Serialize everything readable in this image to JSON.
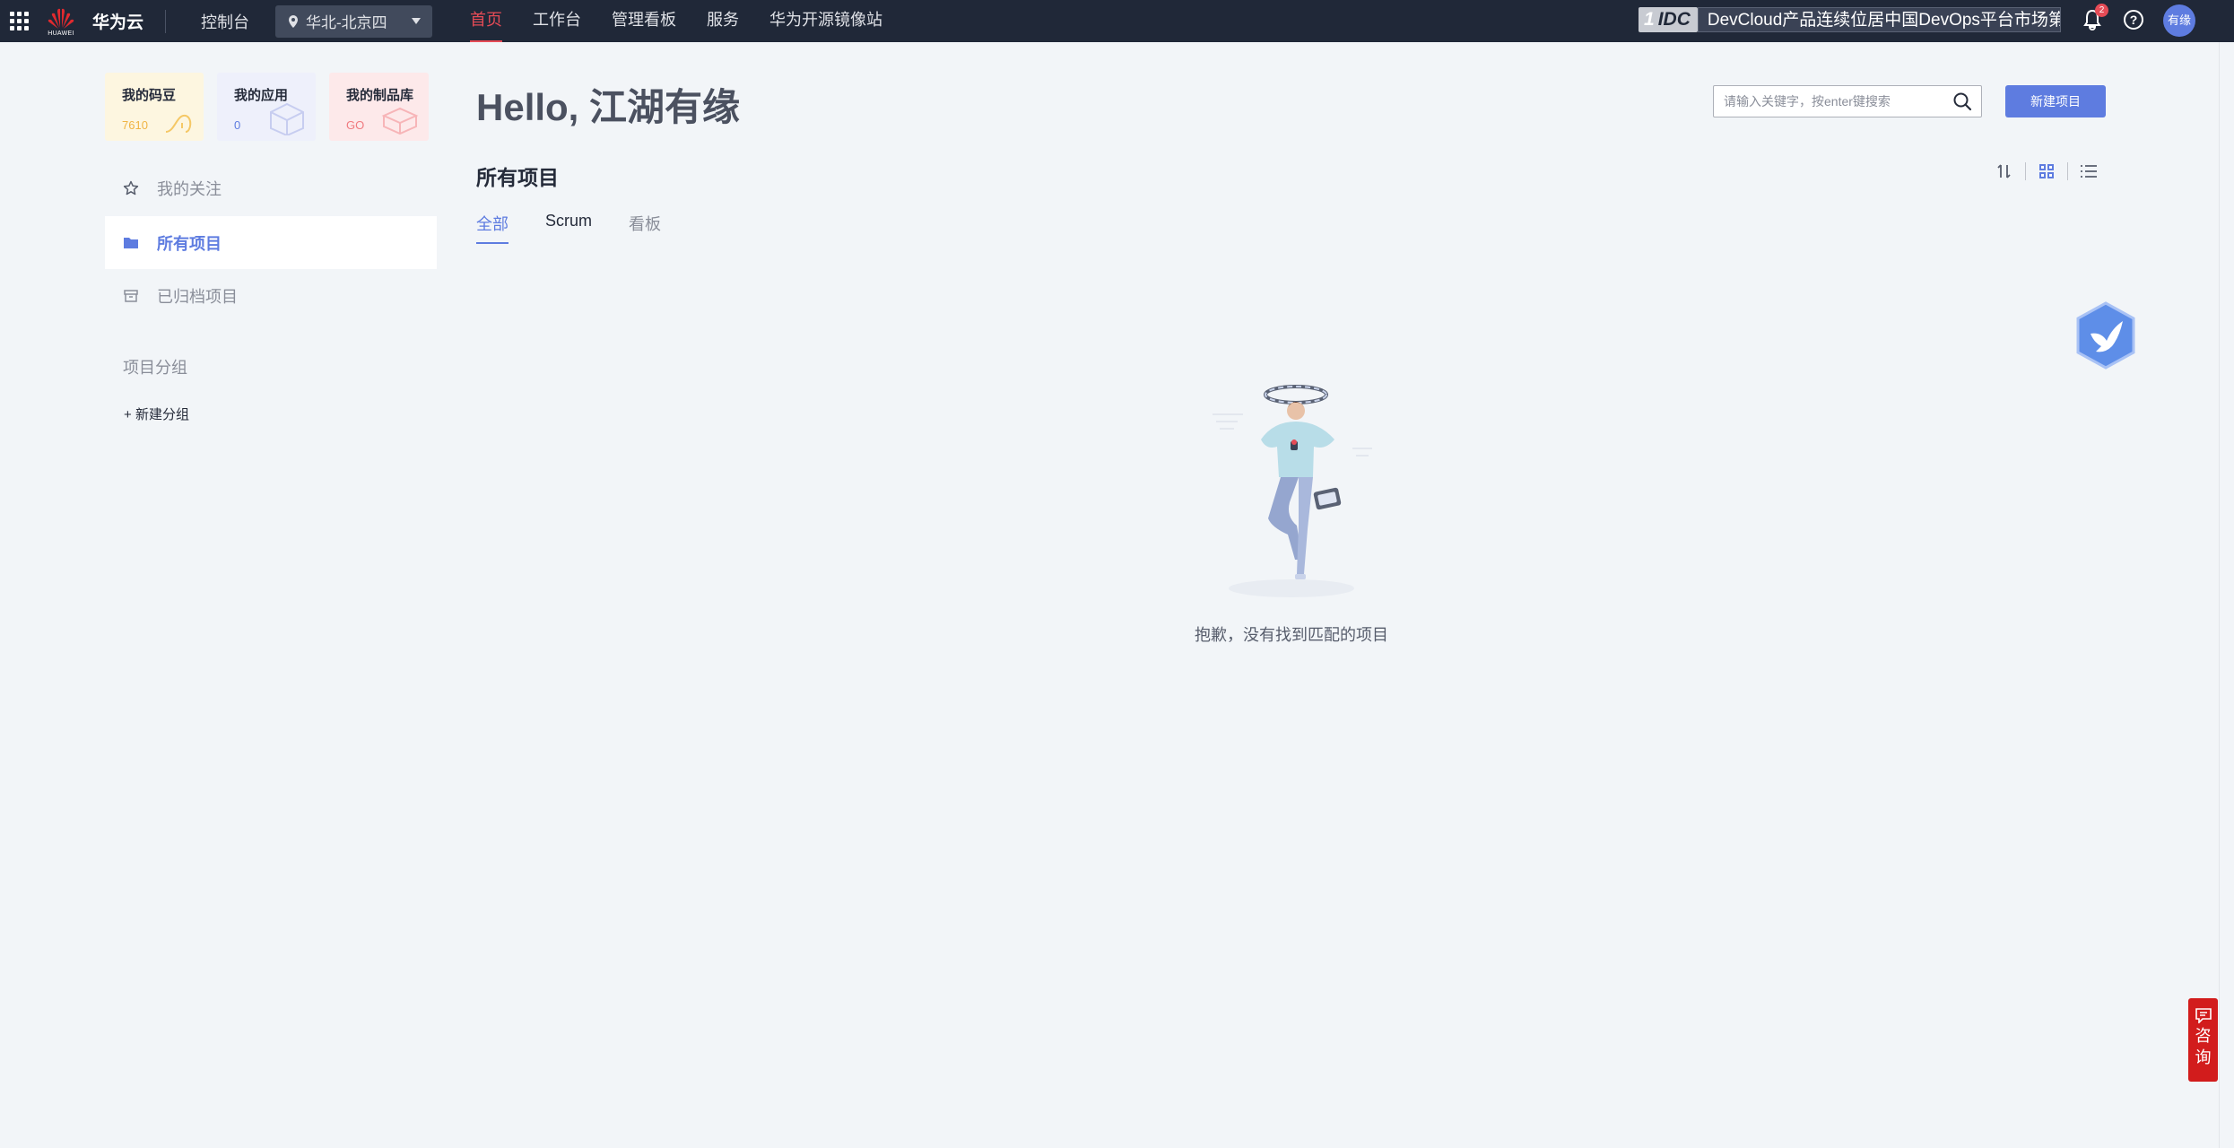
{
  "topbar": {
    "brand": "华为云",
    "logo_text": "HUAWEI",
    "console": "控制台",
    "region": "华北-北京四",
    "nav": [
      {
        "label": "首页",
        "active": true
      },
      {
        "label": "工作台"
      },
      {
        "label": "管理看板"
      },
      {
        "label": "服务"
      },
      {
        "label": "华为开源镜像站"
      }
    ],
    "banner_prefix": "IDC",
    "banner_number": "1",
    "banner_text": "DevCloud产品连续位居中国DevOps平台市场第一",
    "notification_count": "2",
    "help": "?",
    "avatar": "有缘"
  },
  "sidebar": {
    "cards": [
      {
        "title": "我的码豆",
        "value": "7610"
      },
      {
        "title": "我的应用",
        "value": "0"
      },
      {
        "title": "我的制品库",
        "value": "GO"
      }
    ],
    "items": [
      {
        "label": "我的关注",
        "icon": "star-icon"
      },
      {
        "label": "所有项目",
        "icon": "folder-icon",
        "active": true
      },
      {
        "label": "已归档项目",
        "icon": "archive-icon"
      }
    ],
    "group_title": "项目分组",
    "new_group": "新建分组"
  },
  "main": {
    "greeting": "Hello, 江湖有缘",
    "search_placeholder": "请输入关键字，按enter键搜索",
    "new_project": "新建项目",
    "section_title": "所有项目",
    "tabs": [
      {
        "label": "全部",
        "active": true
      },
      {
        "label": "Scrum"
      },
      {
        "label": "看板"
      }
    ],
    "empty_text": "抱歉，没有找到匹配的项目"
  },
  "consult": {
    "label_line1": "咨",
    "label_line2": "询"
  },
  "colors": {
    "accent": "#5e7ce0",
    "nav_bg": "#202838",
    "active_nav": "#e64b56",
    "consult": "#d21c1c"
  }
}
